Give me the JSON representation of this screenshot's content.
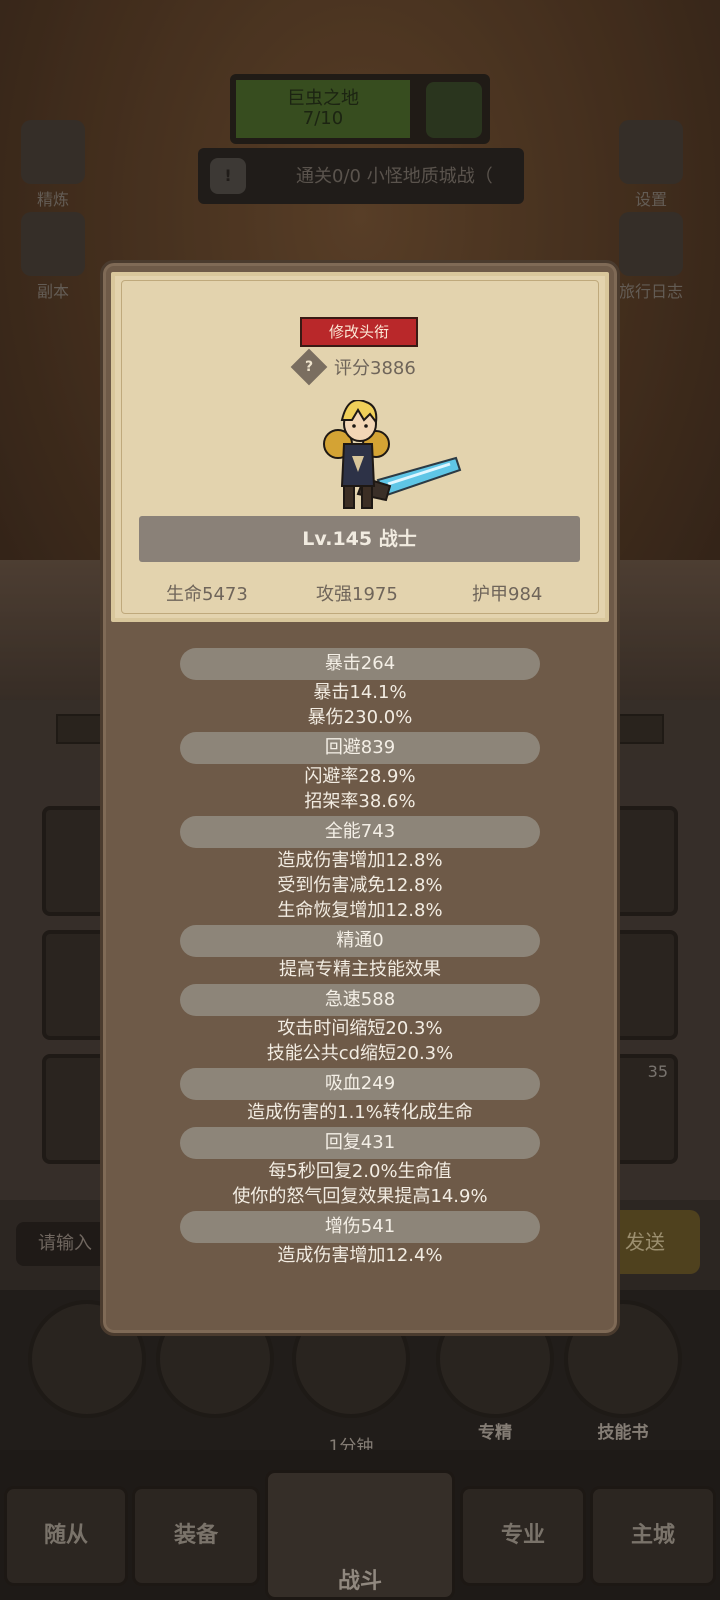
{
  "zone": {
    "name": "巨虫之地",
    "progress": "7/10"
  },
  "quest": {
    "text": "通关0/0 小怪地质城战（"
  },
  "corner_buttons": {
    "top_left_1": "精炼",
    "top_left_2": "副本",
    "top_right_1": "设置",
    "top_right_2": "旅行日志"
  },
  "profile_card": {
    "edit_title_button": "修改头衔",
    "score": "评分3886",
    "level_class": "Lv.145 战士",
    "hp": "生命5473",
    "attack": "攻强1975",
    "armor": "护甲984"
  },
  "stats": [
    {
      "header": "暴击264",
      "lines": [
        "暴击14.1%",
        "暴伤230.0%"
      ]
    },
    {
      "header": "回避839",
      "lines": [
        "闪避率28.9%",
        "招架率38.6%"
      ]
    },
    {
      "header": "全能743",
      "lines": [
        "造成伤害增加12.8%",
        "受到伤害减免12.8%",
        "生命恢复增加12.8%"
      ]
    },
    {
      "header": "精通0",
      "lines": [
        "提高专精主技能效果"
      ]
    },
    {
      "header": "急速588",
      "lines": [
        "攻击时间缩短20.3%",
        "技能公共cd缩短20.3%"
      ]
    },
    {
      "header": "吸血249",
      "lines": [
        "造成伤害的1.1%转化成生命"
      ]
    },
    {
      "header": "回复431",
      "lines": [
        "每5秒回复2.0%生命值",
        "使你的怒气回复效果提高14.9%"
      ]
    },
    {
      "header": "增伤541",
      "lines": [
        "造成伤害增加12.4%"
      ]
    }
  ],
  "chat": {
    "placeholder": "请输入",
    "send_label": "发送"
  },
  "dock": {
    "chest_timer": "1分钟",
    "spec_label": "专精",
    "skillbook_label": "技能书",
    "badge": "35"
  },
  "nav": {
    "follower": "随从",
    "equip": "装备",
    "battle": "战斗",
    "profession": "专业",
    "city": "主城"
  },
  "colors": {
    "card_bg": "#e3d3ae",
    "modal_bg": "#6e5a48",
    "title_red": "#b9282a"
  }
}
